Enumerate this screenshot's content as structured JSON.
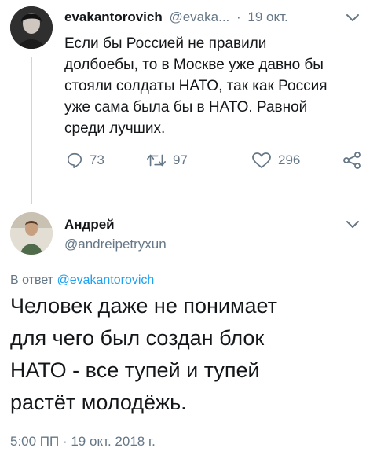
{
  "parent_tweet": {
    "display_name": "evakantorovich",
    "handle": "@evaka...",
    "separator": "·",
    "date": "19 окт.",
    "text": "Если бы Россией не правили долбоебы, то в Москве уже давно бы стояли солдаты НАТО, так как Россия уже сама была бы в НАТО.  Равной среди лучших.",
    "text_lines": [
      "Если бы Россией не правили",
      "долбоебы, то в Москве уже давно бы",
      "стояли солдаты НАТО, так как Россия",
      "уже сама была бы в НАТО.  Равной",
      "среди лучших."
    ],
    "actions": {
      "reply_count": "73",
      "retweet_count": "97",
      "like_count": "296"
    }
  },
  "reply_tweet": {
    "display_name": "Андрей",
    "handle": "@andreipetryxun",
    "reply_prefix": "В ответ",
    "reply_to": "@evakantorovich",
    "text_lines": [
      "Человек даже не понимает",
      "для чего был создан блок",
      "НАТО - все тупей и тупей",
      "растёт молодёжь."
    ],
    "timestamp": "5:00 ПП · 19 окт. 2018 г."
  },
  "colors": {
    "accent": "#1da1f2",
    "muted": "#657786",
    "text": "#14171a",
    "line": "#ccd6dd"
  },
  "icons": [
    "reply-icon",
    "retweet-icon",
    "like-icon",
    "share-icon",
    "chevron-down-icon"
  ]
}
